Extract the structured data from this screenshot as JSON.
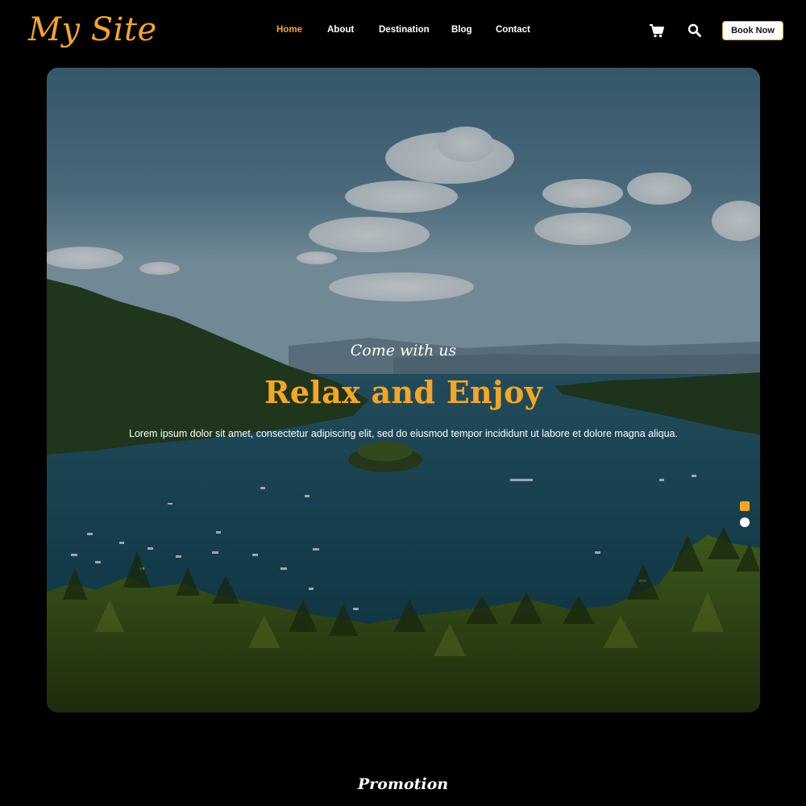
{
  "header": {
    "logo": "My Site",
    "nav": [
      {
        "label": "Home",
        "active": true
      },
      {
        "label": "About"
      },
      {
        "label": "Destination"
      },
      {
        "label": "Blog"
      },
      {
        "label": "Contact"
      }
    ],
    "icons": [
      "cart-icon",
      "search-icon"
    ],
    "book_label": "Book Now"
  },
  "hero": {
    "subtitle": "Come with us",
    "title": "Relax and Enjoy",
    "text": "Lorem ipsum dolor sit amet, consectetur adipiscing elit, sed do eiusmod tempor incididunt ut labore et dolore magna aliqua.",
    "slides": 2,
    "active_slide": 1
  },
  "promotion": {
    "title": "Promotion"
  },
  "colors": {
    "accent": "#f5a623",
    "background": "#000000",
    "text": "#ffffff"
  }
}
